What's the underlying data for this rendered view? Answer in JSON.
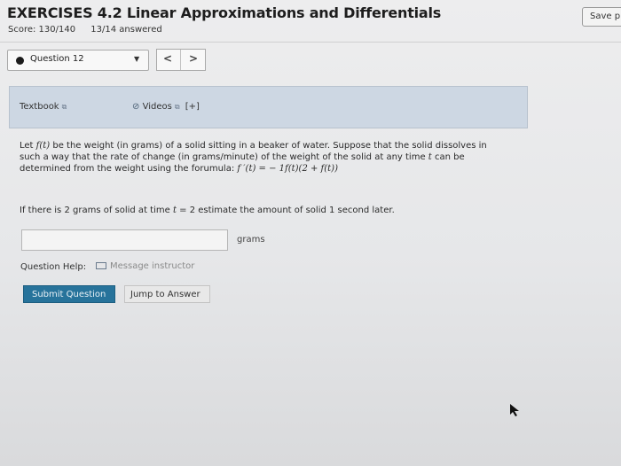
{
  "header": {
    "title": "EXERCISES 4.2 Linear Approximations and Differentials",
    "score": "Score: 130/140",
    "answered": "13/14 answered",
    "save_label": "Save p"
  },
  "question_nav": {
    "selected": "Question 12",
    "prev": "<",
    "next": ">"
  },
  "resources": {
    "textbook": "Textbook",
    "videos": "Videos",
    "videos_toggle": "[+]"
  },
  "question": {
    "line1_a": "Let ",
    "line1_b": " be the weight (in grams) of a solid sitting in a beaker of water. Suppose that the solid dissolves in",
    "line2_a": "such a way that the rate of change (in grams/minute) of the weight of the solid at any time ",
    "line2_b": " can be",
    "line3_a": "determined from the weight using the forumula: ",
    "f_t": "f(t)",
    "t_var": "t",
    "formula": "f ′(t) = − 1f(t)(2 + f(t))",
    "prompt_a": "If there is 2 grams of solid at time ",
    "prompt_b": " = 2 estimate the amount of solid 1 second later.",
    "answer_value": "",
    "units": "grams"
  },
  "help": {
    "label": "Question Help:",
    "message": "Message instructor"
  },
  "actions": {
    "submit": "Submit Question",
    "jump": "Jump to Answer"
  },
  "colors": {
    "submit_bg": "#27739b",
    "panel_bg": "#cdd7e3"
  }
}
